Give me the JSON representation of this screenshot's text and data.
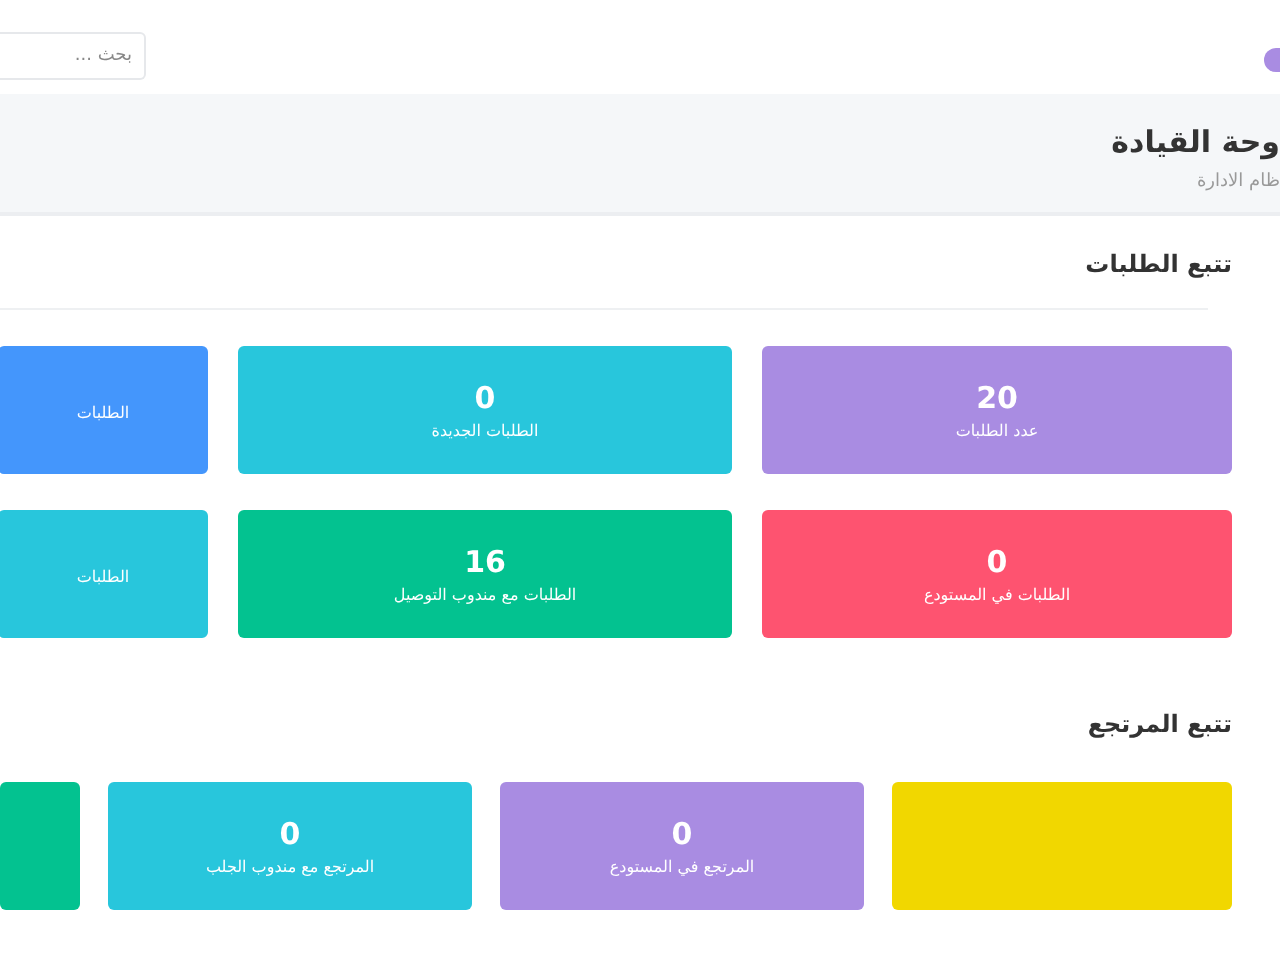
{
  "topbar": {
    "search": {
      "placeholder": "بحث ..."
    }
  },
  "header": {
    "title": "وحة القيادة",
    "subtitle": "ظام الادارة"
  },
  "orders": {
    "title": "تتبع الطلبات",
    "cards": [
      {
        "value": "20",
        "label": "عدد الطلبات",
        "color": "#a98ce2"
      },
      {
        "value": "0",
        "label": "الطلبات الجديدة",
        "color": "#28c6dc"
      },
      {
        "label": "الطلبات",
        "color": "#4496fc"
      },
      {
        "value": "0",
        "label": "الطلبات في المستودع",
        "color": "#fe5370"
      },
      {
        "value": "16",
        "label": "الطلبات مع مندوب التوصيل",
        "color": "#03c290"
      },
      {
        "label": "الطلبات",
        "color": "#28c6dc"
      }
    ]
  },
  "returns": {
    "title": "تتبع المرتجع",
    "cards": [
      {
        "color": "#f1d700"
      },
      {
        "value": "0",
        "label": "المرتجع في المستودع",
        "color": "#a98ce2"
      },
      {
        "value": "0",
        "label": "المرتجع مع مندوب الجلب",
        "color": "#28c6dc"
      },
      {
        "color": "#03c290"
      }
    ]
  }
}
